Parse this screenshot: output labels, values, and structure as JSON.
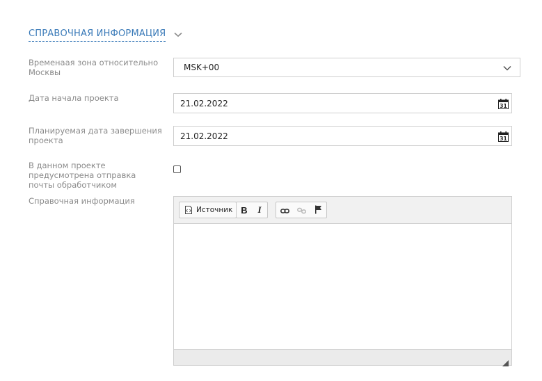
{
  "section": {
    "title": "СПРАВОЧНАЯ ИНФОРМАЦИЯ",
    "toggle_icon": "chevron-down-icon"
  },
  "fields": {
    "timezone": {
      "label": "Временаая зона относительно Москвы",
      "value": "MSK+00",
      "icon": "chevron-down-icon"
    },
    "start_date": {
      "label": "Дата начала проекта",
      "value": "21.02.2022",
      "icon": "calendar-icon",
      "icon_text": "31"
    },
    "end_date": {
      "label": "Планируемая дата завершения проекта",
      "value": "21.02.2022",
      "icon": "calendar-icon",
      "icon_text": "31"
    },
    "mail_sending": {
      "label": "В данном проекте предусмотрена отправка почты обработчиком",
      "checked": false
    },
    "info": {
      "label": "Справочная информация"
    }
  },
  "editor": {
    "toolbar": {
      "source_label": "Источник",
      "bold_label": "B",
      "italic_label": "I",
      "icons": [
        "source-icon",
        "link-icon",
        "unlink-icon",
        "anchor-flag-icon",
        "resize-handle-icon"
      ]
    },
    "content": ""
  },
  "colors": {
    "accent": "#3a7ab8",
    "label": "#8a8a8a",
    "border": "#cfcfcf",
    "toolbar_bg": "#f1f1f1"
  }
}
